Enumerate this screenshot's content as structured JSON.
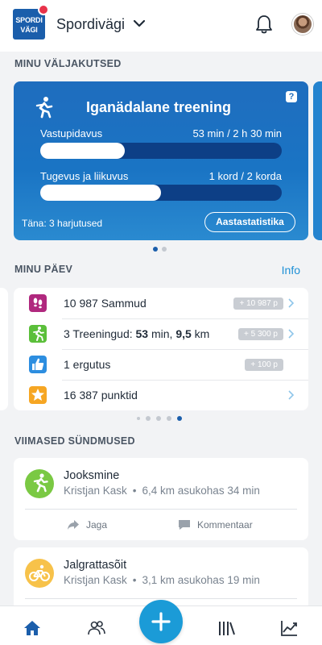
{
  "header": {
    "logo_line1": "SPORDI",
    "logo_line2": "VÄGI",
    "title": "Spordivägi",
    "icons": [
      "chevron-down-icon",
      "bell-icon",
      "avatar"
    ]
  },
  "challenges": {
    "section_title": "MINU VÄLJAKUTSED",
    "card": {
      "title": "Iganädalane treening",
      "help": "?",
      "bars": [
        {
          "label": "Vastupidavus",
          "value": "53 min / 2 h 30 min",
          "progress": 0.35
        },
        {
          "label": "Tugevus ja liikuvus",
          "value": "1 kord / 2 korda",
          "progress": 0.5
        }
      ],
      "today": "Täna: 3 harjutused",
      "stats_button": "Aastastatistika"
    },
    "page_count": 2,
    "active_page": 0
  },
  "my_day": {
    "section_title": "MINU PÄEV",
    "info_link": "Info",
    "rows": [
      {
        "icon": "footsteps-icon",
        "color": "#b0287e",
        "text_strong": "",
        "text": "10 987 Sammud",
        "badge": "+ 10 987 p",
        "has_chevron": true
      },
      {
        "icon": "runner-icon",
        "color": "#5bbf3a",
        "text": "3 Treeningud: ",
        "strong1": "53",
        "mid": " min, ",
        "strong2": "9,5",
        "end": " km",
        "badge": "+ 5 300 p",
        "has_chevron": true
      },
      {
        "icon": "thumbs-up-icon",
        "color": "#2d8ee0",
        "text": "1 ergutus",
        "badge": "+ 100 p",
        "has_chevron": false
      },
      {
        "icon": "star-icon",
        "color": "#f6a623",
        "text": "16 387 punktid",
        "badge": "",
        "has_chevron": true
      }
    ],
    "page_count": 5,
    "active_page": 4
  },
  "events": {
    "section_title": "VIIMASED SÜNDMUSED",
    "items": [
      {
        "icon": "runner-icon",
        "color": "#7ac943",
        "title": "Jooksmine",
        "user": "Kristjan Kask",
        "detail": "6,4 km asukohas 34 min",
        "share": "Jaga",
        "comment": "Kommentaar"
      },
      {
        "icon": "bicycle-icon",
        "color": "#f7c24a",
        "title": "Jalgrattasõit",
        "user": "Kristjan Kask",
        "detail": "3,1 km asukohas 19 min"
      }
    ]
  },
  "bottom_nav": {
    "items": [
      "home-icon",
      "people-icon",
      "add-button",
      "library-icon",
      "chart-icon"
    ],
    "active": "home-icon",
    "colors": {
      "active": "#1b5eab",
      "inactive": "#2b3440",
      "fab": "#1b9bd7"
    }
  }
}
